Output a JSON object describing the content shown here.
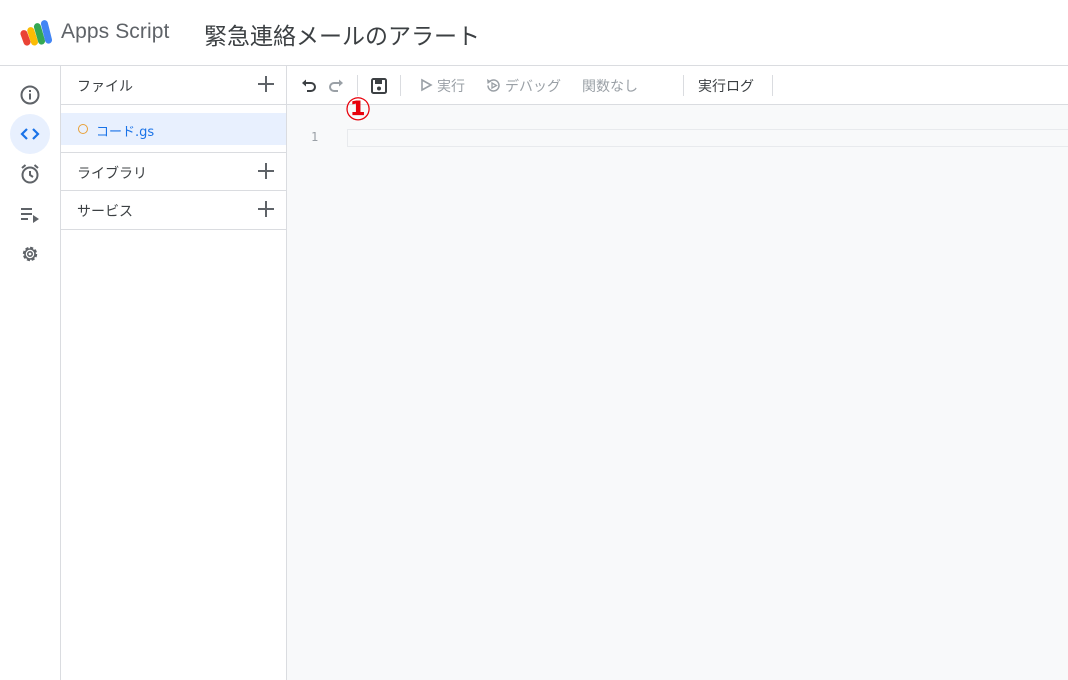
{
  "header": {
    "brand": "Apps Script",
    "project_title": "緊急連絡メールのアラート"
  },
  "rail": {
    "items": [
      {
        "icon": "info-icon",
        "active": false
      },
      {
        "icon": "code-icon",
        "active": true
      },
      {
        "icon": "alarm-clock-icon",
        "active": false
      },
      {
        "icon": "executions-icon",
        "active": false
      },
      {
        "icon": "gear-icon",
        "active": false
      }
    ]
  },
  "panel": {
    "files_label": "ファイル",
    "file_name": "コード.gs",
    "libraries_label": "ライブラリ",
    "services_label": "サービス"
  },
  "toolbar": {
    "run_label": "実行",
    "debug_label": "デバッグ",
    "function_select": "関数なし",
    "log_label": "実行ログ"
  },
  "editor": {
    "line_number": "1",
    "marker": "①"
  },
  "colors": {
    "accent": "#1a73e8",
    "active_bg": "#e8f0fe",
    "marker": "#e8000b",
    "file_dot": "#e8a13a"
  }
}
